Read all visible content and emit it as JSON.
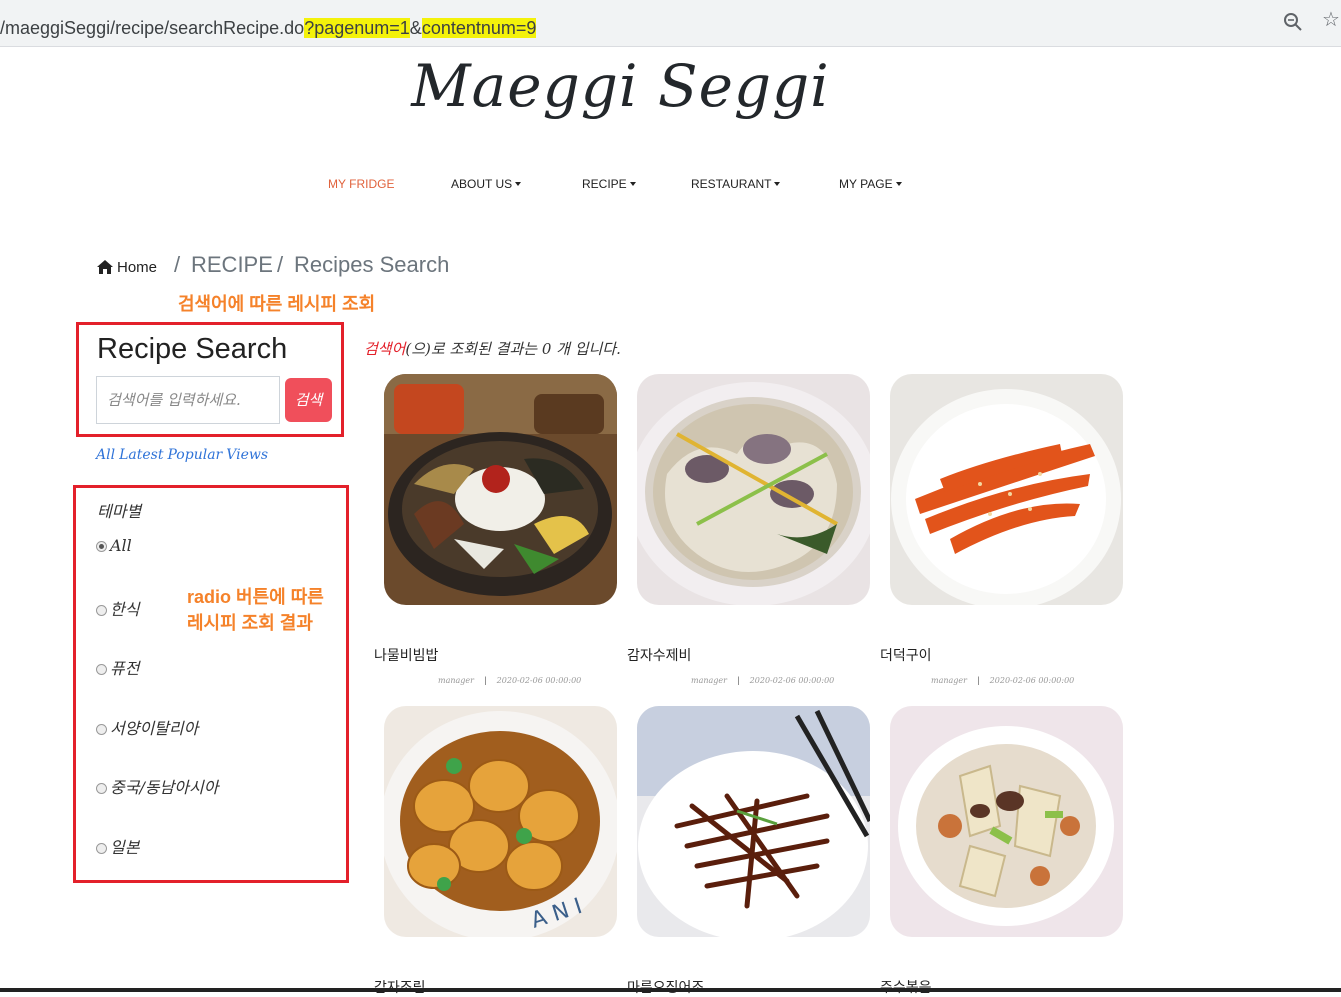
{
  "browser": {
    "url_prefix": "/maeggiSeggi/recipe/searchRecipe.do",
    "url_q": "?",
    "url_param1": "pagenum=1",
    "url_amp": "&",
    "url_param2": "contentnum=9"
  },
  "brand": "Maeggi Seggi",
  "nav": {
    "items": [
      {
        "label": "MY FRIDGE",
        "active": true,
        "dropdown": false
      },
      {
        "label": "ABOUT US",
        "active": false,
        "dropdown": true
      },
      {
        "label": "RECIPE",
        "active": false,
        "dropdown": true
      },
      {
        "label": "RESTAURANT",
        "active": false,
        "dropdown": true
      },
      {
        "label": "MY PAGE",
        "active": false,
        "dropdown": true
      }
    ]
  },
  "breadcrumb": {
    "home": "Home",
    "sep": "/",
    "level1": "RECIPE",
    "level2": "Recipes Search"
  },
  "annotations": {
    "search_note": "검색어에 따른 레시피 조회",
    "radio_note_line1": "radio 버튼에 따른",
    "radio_note_line2": "레시피 조회 결과"
  },
  "search": {
    "title": "Recipe Search",
    "placeholder": "검색어를 입력하세요.",
    "button": "검색",
    "sort_links": [
      "All",
      "Latest",
      "Popular",
      "Views"
    ]
  },
  "theme": {
    "title": "테마별",
    "options": [
      {
        "label": "All",
        "checked": true
      },
      {
        "label": "한식",
        "checked": false
      },
      {
        "label": "퓨전",
        "checked": false
      },
      {
        "label": "서양이탈리아",
        "checked": false
      },
      {
        "label": "중국/동남아시아",
        "checked": false
      },
      {
        "label": "일본",
        "checked": false
      }
    ]
  },
  "results": {
    "keyword": "검색어",
    "message": "(으)로 조회된 결과는 0 개 입니다.",
    "cards": [
      {
        "title": "나물비빔밥",
        "author": "manager",
        "date": "2020-02-06 00:00:00",
        "image": "bibimbap"
      },
      {
        "title": "감자수제비",
        "author": "manager",
        "date": "2020-02-06 00:00:00",
        "image": "sujebi"
      },
      {
        "title": "더덕구이",
        "author": "manager",
        "date": "2020-02-06 00:00:00",
        "image": "deodeok"
      },
      {
        "title": "감자조림",
        "image": "potato"
      },
      {
        "title": "마른오징어조",
        "image": "squid"
      },
      {
        "title": "주수볶음",
        "image": "stirfry"
      }
    ]
  },
  "colors": {
    "accent_red": "#e3202a",
    "button_red": "#f04f5b",
    "nav_active": "#e0623c",
    "annotation_orange": "#f5822a",
    "link_blue": "#2f73d8",
    "url_highlight": "#f4f20a"
  }
}
